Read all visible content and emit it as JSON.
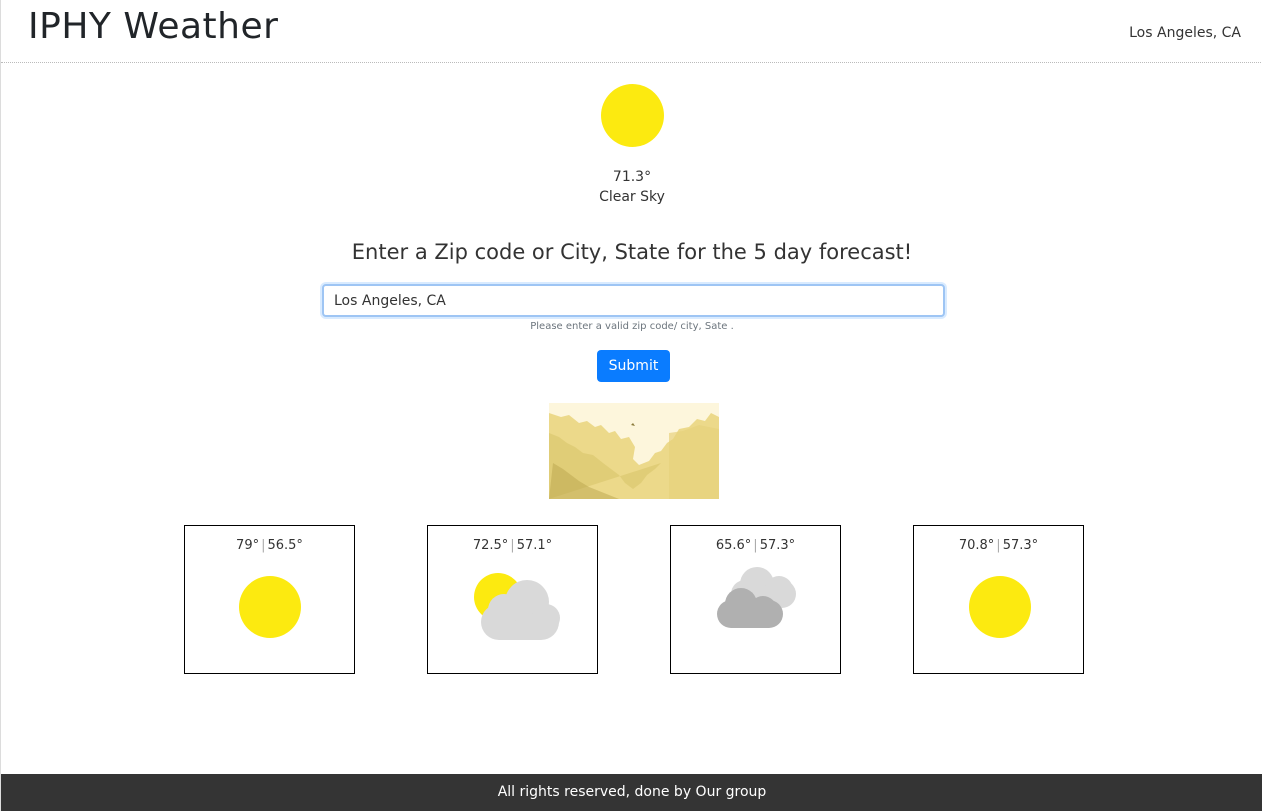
{
  "header": {
    "brand": "IPHY Weather",
    "location": "Los Angeles, CA"
  },
  "current": {
    "icon": "sun-icon",
    "temperature": "71.3°",
    "description": "Clear Sky"
  },
  "search": {
    "prompt": "Enter a Zip code or City, State for the 5 day forecast!",
    "value": "Los Angeles, CA",
    "hint": "Please enter a valid zip code/ city, Sate .",
    "submit_label": "Submit"
  },
  "map": {
    "icon": "weather-map-image"
  },
  "forecast": [
    {
      "high": "79°",
      "low": "56.5°",
      "icon": "sun-icon"
    },
    {
      "high": "72.5°",
      "low": "57.1°",
      "icon": "partly-cloudy-icon"
    },
    {
      "high": "65.6°",
      "low": "57.3°",
      "icon": "cloudy-icon"
    },
    {
      "high": "70.8°",
      "low": "57.3°",
      "icon": "sun-icon"
    }
  ],
  "footer": {
    "text": "All rights reserved, done by Our group"
  },
  "colors": {
    "sun": "#fcea10",
    "button": "#0a7cff",
    "footer_bg": "#343434",
    "cloud_light": "#d9d9d9",
    "cloud_dark": "#b0b0b0"
  }
}
